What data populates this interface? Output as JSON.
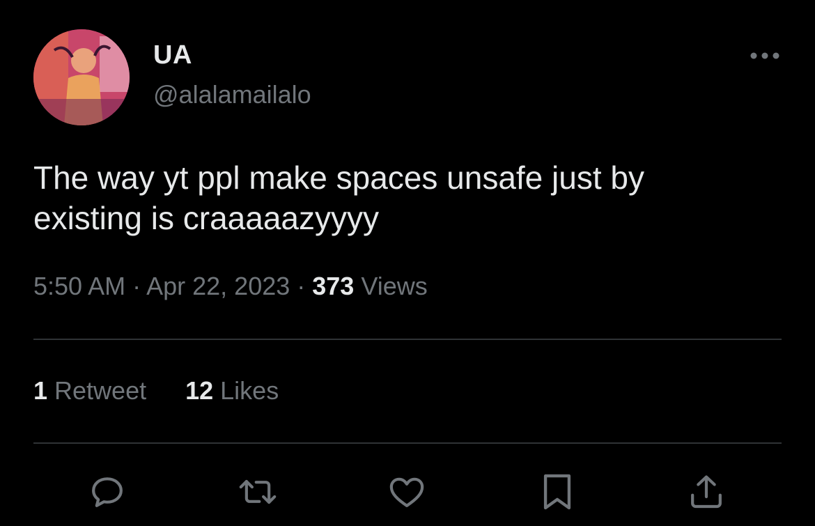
{
  "user": {
    "display_name": "UA",
    "handle": "@alalamailalo",
    "avatar_icon": "profile-avatar"
  },
  "tweet": {
    "text_line1": "The way yt ppl make spaces unsafe just by",
    "text_line2": "existing is craaaaazyyyy"
  },
  "meta": {
    "time": "5:50 AM",
    "separator": " · ",
    "date": "Apr 22, 2023",
    "views_count": "373",
    "views_label": " Views"
  },
  "stats": {
    "retweets_count": "1",
    "retweets_label": " Retweet",
    "likes_count": "12",
    "likes_label": " Likes"
  },
  "actions": [
    "reply-icon",
    "retweet-icon",
    "like-icon",
    "bookmark-icon",
    "share-icon"
  ],
  "colors": {
    "background": "#000000",
    "primary_text": "#e7e9ea",
    "secondary_text": "#71767b",
    "divider": "#2f3336"
  }
}
